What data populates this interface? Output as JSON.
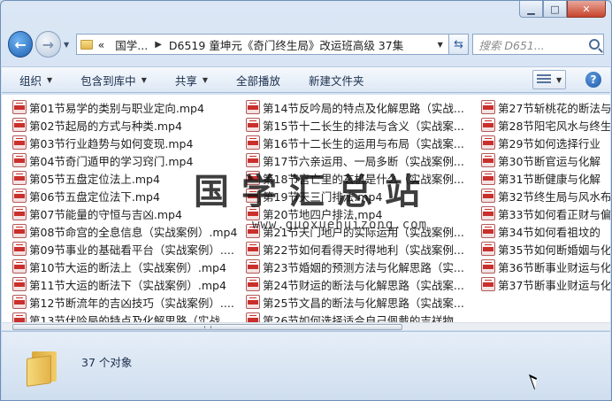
{
  "window": {
    "controls": {
      "minimize": "▁",
      "maximize": "□",
      "close": "✕"
    }
  },
  "nav": {
    "back_glyph": "←",
    "forward_glyph": "→",
    "history_dropdown": "▼"
  },
  "address": {
    "chevron": "«",
    "crumbs": [
      "国学...",
      "D6519 童坤元《奇门终生局》改运班高级 37集"
    ],
    "separator": "▶",
    "dropdown": "▼"
  },
  "search": {
    "placeholder": "搜索 D651..."
  },
  "toolbar": {
    "organize": "组织",
    "include_in_library": "包含到库中",
    "share": "共享",
    "play_all": "全部播放",
    "new_folder": "新建文件夹",
    "dropdown_glyph": "▼",
    "help_glyph": "?"
  },
  "files": {
    "col1": [
      "第01节易学的类别与职业定向.mp4",
      "第02节起局的方式与种类.mp4",
      "第03节行业趋势与如何变现.mp4",
      "第04节奇门遁甲的学习窍门.mp4",
      "第05节五盘定位法上.mp4",
      "第06节五盘定位法下.mp4",
      "第07节能量的守恒与吉凶.mp4",
      "第08节命宫的全息信息（实战案例）.mp4",
      "第09节事业的基础看平台（实战案例）....",
      "第10节大运的断法上（实战案例）.mp4",
      "第11节大运的断法下（实战案例）.mp4",
      "第12节断流年的吉凶技巧（实战案例）....",
      "第13节伏吟局的特点及化解思路（实战..."
    ],
    "col2": [
      "第14节反吟局的特点及化解思路（实战...",
      "第15节十二长生的排法与含义（实战案...",
      "第16节十二长生的运用与布局（实战案...",
      "第17节六亲运用、一局多断（实战案例...",
      "第18节宫亡里的玄机是什么（实战案例...",
      "第19节天三门排法.mp4",
      "第20节地四户排法.mp4",
      "第21节天门地户的实际运用（实战案例...",
      "第22节如何看得天时得地利（实战案例...",
      "第23节婚姻的预测方法与化解思路（实...",
      "第24节财运的断法与化解思路（实战案...",
      "第25节文昌的断法与化解思路（实战案...",
      "第26节如何选择适合自己佩戴的吉祥物..."
    ],
    "col3": [
      "第27节斩桃花的断法与化解",
      "第28节阳宅风水与终生局",
      "第29节如何选择行业",
      "第30节断官运与化解",
      "第31节断健康与化解",
      "第32节终生局与风水布局",
      "第33节如何看正财与偏财",
      "第34节如何看祖坟的",
      "第35节如何断婚姻与化解",
      "第36节断事业财运与化解",
      "第37节断事业财运与化解"
    ]
  },
  "watermark": {
    "text": "国学汇总站",
    "url": "www.guoxuehuizong.com"
  },
  "status": {
    "item_count": "37 个对象"
  }
}
